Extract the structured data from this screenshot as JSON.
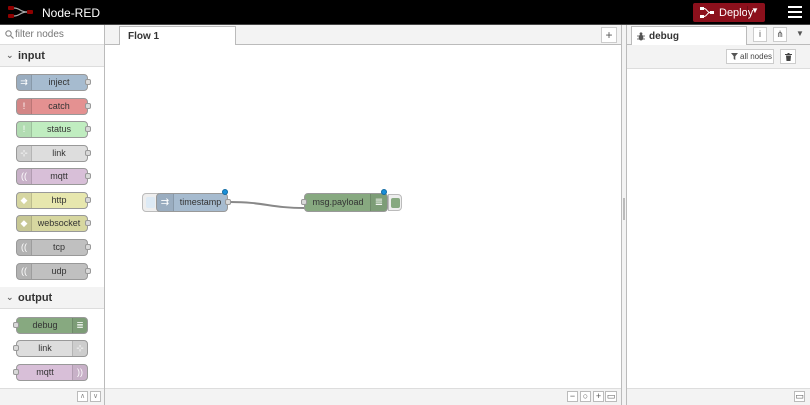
{
  "header": {
    "title": "Node-RED",
    "deploy_label": "Deploy"
  },
  "palette": {
    "filter_placeholder": "filter nodes",
    "categories": [
      {
        "label": "input",
        "nodes": [
          {
            "label": "inject",
            "color": "#a6bbcf",
            "icon": "arrow-icon"
          },
          {
            "label": "catch",
            "color": "#e49191",
            "icon": "exclamation-icon"
          },
          {
            "label": "status",
            "color": "#c0edc0",
            "icon": "exclamation-icon"
          },
          {
            "label": "link",
            "color": "#dddddd",
            "icon": "link-icon"
          },
          {
            "label": "mqtt",
            "color": "#d8bfd8",
            "icon": "wave-icon"
          },
          {
            "label": "http",
            "color": "#e7e7ae",
            "icon": "globe-icon"
          },
          {
            "label": "websocket",
            "color": "#d7d7a0",
            "icon": "globe-icon"
          },
          {
            "label": "tcp",
            "color": "#c0c0c0",
            "icon": "wave-icon"
          },
          {
            "label": "udp",
            "color": "#c0c0c0",
            "icon": "wave-icon"
          }
        ]
      },
      {
        "label": "output",
        "nodes": [
          {
            "label": "debug",
            "color": "#87a980",
            "icon": "list-icon"
          },
          {
            "label": "link",
            "color": "#dddddd",
            "icon": "link-icon"
          },
          {
            "label": "mqtt",
            "color": "#d8bfd8",
            "icon": "wave-icon"
          }
        ]
      }
    ]
  },
  "workspace": {
    "tab_label": "Flow 1",
    "nodes": [
      {
        "label": "timestamp",
        "color": "#a6bbcf",
        "type": "inject"
      },
      {
        "label": "msg.payload",
        "color": "#87a980",
        "type": "debug"
      }
    ]
  },
  "sidebar": {
    "tab_label": "debug",
    "filter_label": "all nodes"
  }
}
